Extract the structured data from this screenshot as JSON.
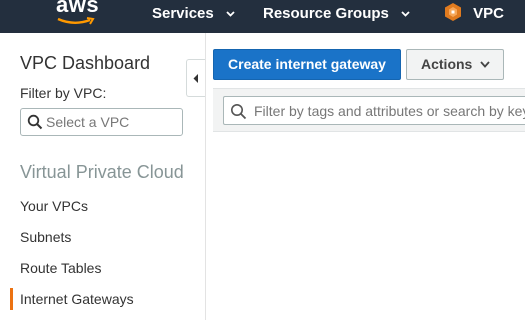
{
  "topnav": {
    "logo": "aws",
    "services": "Services",
    "resource_groups": "Resource Groups",
    "vpc": "VPC"
  },
  "sidebar": {
    "title": "VPC Dashboard",
    "filter_label": "Filter by VPC:",
    "filter_placeholder": "Select a VPC",
    "section": "Virtual Private Cloud",
    "items": [
      {
        "label": "Your VPCs"
      },
      {
        "label": "Subnets"
      },
      {
        "label": "Route Tables"
      },
      {
        "label": "Internet Gateways",
        "active": true
      }
    ]
  },
  "toolbar": {
    "create_label": "Create internet gateway",
    "actions_label": "Actions"
  },
  "filter": {
    "placeholder": "Filter by tags and attributes or search by keyword"
  },
  "colors": {
    "topbar": "#232f3e",
    "primary_button": "#1a73c8",
    "active_indicator": "#ec7211",
    "vpc_logo": "#e07b1f"
  },
  "icons": {
    "nav_dropdown": "chevron-down-icon",
    "vpc": "vpc-icon",
    "search": "search-icon",
    "collapse": "chevron-left-icon",
    "actions_dropdown": "caret-down-icon"
  }
}
